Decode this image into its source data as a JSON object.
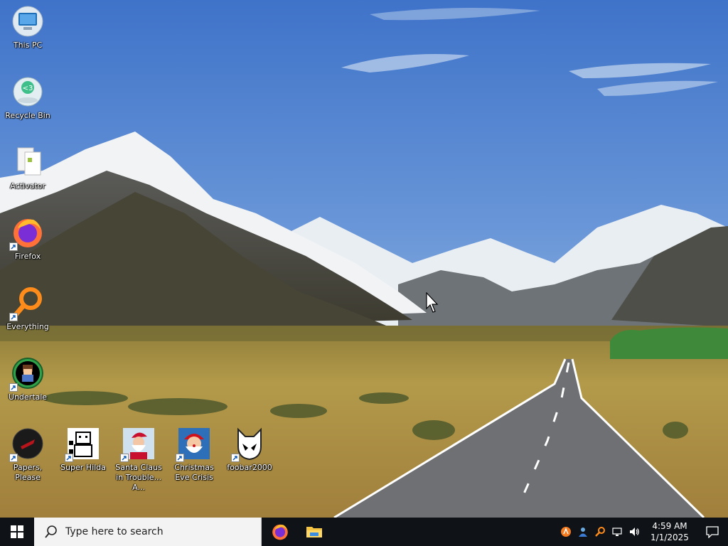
{
  "desktop": {
    "icons": [
      {
        "label": "This PC",
        "icon": "computer-icon",
        "shortcut": false
      },
      {
        "label": "Recycle Bin",
        "icon": "recycle-bin-icon",
        "shortcut": false
      },
      {
        "label": "Activator",
        "icon": "activator-file-icon",
        "shortcut": false
      },
      {
        "label": "Firefox",
        "icon": "firefox-icon",
        "shortcut": true
      },
      {
        "label": "Everything",
        "icon": "everything-search-icon",
        "shortcut": true
      },
      {
        "label": "Undertale",
        "icon": "undertale-icon",
        "shortcut": true
      },
      {
        "label": "Papers, Please",
        "icon": "papers-please-icon",
        "shortcut": true
      },
      {
        "label": "Super Hilda",
        "icon": "super-hilda-icon",
        "shortcut": true
      },
      {
        "label": "Santa Claus in Trouble... A...",
        "icon": "santa-claus-icon",
        "shortcut": true
      },
      {
        "label": "Christmas Eve Crisis",
        "icon": "christmas-eve-crisis-icon",
        "shortcut": true
      },
      {
        "label": "foobar2000",
        "icon": "foobar2000-icon",
        "shortcut": true
      }
    ]
  },
  "taskbar": {
    "start_icon": "windows-logo-icon",
    "search_placeholder": "Type here to search",
    "pinned_apps": [
      {
        "name": "Firefox",
        "icon": "firefox-icon"
      },
      {
        "name": "File Explorer",
        "icon": "folder-icon"
      }
    ],
    "tray_icons": [
      "avast-icon",
      "network-user-icon",
      "everything-tray-icon",
      "network-icon",
      "volume-icon"
    ],
    "clock": {
      "time": "4:59 AM",
      "date": "1/1/2025"
    },
    "notification_icon": "notification-icon"
  },
  "colors": {
    "taskbar_bg": "#0f1216",
    "sky_top": "#3f73c9",
    "sky_bottom": "#a6c4e3",
    "grass": "#a28a3a",
    "road": "#6e7073"
  }
}
